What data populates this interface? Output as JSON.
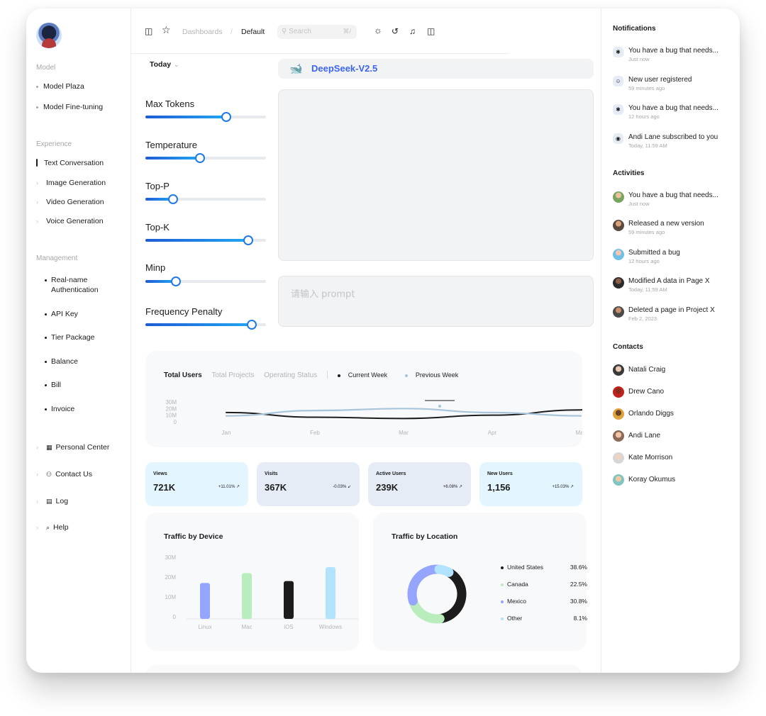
{
  "sidebar": {
    "sections": {
      "model": "Model",
      "experience": "Experience",
      "management": "Management"
    },
    "model_items": [
      "Model Plaza",
      "Model Fine-tuning"
    ],
    "experience_items": [
      "Text Conversation",
      "Image Generation",
      "Video Generation",
      "Voice Generation"
    ],
    "management_items": [
      "Real-name",
      "Authentication",
      "API Key",
      "Tier Package",
      "Balance",
      "Bill",
      "Invoice"
    ],
    "bottom_items": [
      "Personal Center",
      "Contact Us",
      "Log",
      "Help"
    ]
  },
  "header": {
    "breadcrumb_root": "Dashboards",
    "breadcrumb_sep": "/",
    "breadcrumb_current": "Default",
    "search_placeholder": "Search",
    "search_shortcut": "⌘/"
  },
  "settings": {
    "period": "Today",
    "sliders": [
      {
        "label": "Max Tokens",
        "level_pct": 67
      },
      {
        "label": "Temperature",
        "level_pct": 45
      },
      {
        "label": "Top-P",
        "level_pct": 23
      },
      {
        "label": "Top-K",
        "level_pct": 85
      },
      {
        "label": "Minp",
        "level_pct": 25
      },
      {
        "label": "Frequency Penalty",
        "level_pct": 88
      }
    ]
  },
  "chat": {
    "model_name": "DeepSeek-V2.5",
    "prompt_placeholder": "请输入 prompt"
  },
  "users_card": {
    "tabs": [
      "Total Users",
      "Total Projects",
      "Operating Status"
    ],
    "legend": [
      "Current Week",
      "Previous Week"
    ]
  },
  "stats": [
    {
      "title": "Views",
      "value": "721K",
      "change": "+11.01%",
      "bg": "#e3f5ff"
    },
    {
      "title": "Visits",
      "value": "367K",
      "change": "-0.03%",
      "bg": "#e5ecf6"
    },
    {
      "title": "Active Users",
      "value": "239K",
      "change": "+6.08%",
      "bg": "#e5ecf6"
    },
    {
      "title": "New Users",
      "value": "1,156",
      "change": "+15.03%",
      "bg": "#e3f5ff"
    }
  ],
  "device_card": {
    "title": "Traffic by Device"
  },
  "location_card": {
    "title": "Traffic by Location",
    "rows": [
      {
        "name": "United States",
        "pct": "38.6%",
        "color": "#1c1c1c"
      },
      {
        "name": "Canada",
        "pct": "22.5%",
        "color": "#baedbd"
      },
      {
        "name": "Mexico",
        "pct": "30.8%",
        "color": "#95a4fc"
      },
      {
        "name": "Other",
        "pct": "8.1%",
        "color": "#b1e3ff"
      }
    ]
  },
  "notifications": {
    "title": "Notifications",
    "items": [
      {
        "text": "You have a bug that needs...",
        "time": "Just now",
        "icon": "bug-icon"
      },
      {
        "text": "New user registered",
        "time": "59 minutes ago",
        "icon": "user-icon"
      },
      {
        "text": "You have a bug that needs...",
        "time": "12 hours ago",
        "icon": "bug-icon"
      },
      {
        "text": "Andi Lane subscribed to you",
        "time": "Today, 11:59 AM",
        "icon": "broadcast-icon"
      }
    ]
  },
  "activities": {
    "title": "Activities",
    "items": [
      {
        "text": "You have a bug that needs...",
        "time": "Just now"
      },
      {
        "text": "Released a new version",
        "time": "59 minutes ago"
      },
      {
        "text": "Submitted a bug",
        "time": "12 hours ago"
      },
      {
        "text": "Modified A data in Page X",
        "time": "Today, 11:59 AM"
      },
      {
        "text": "Deleted a page in Project X",
        "time": "Feb 2, 2023"
      }
    ]
  },
  "contacts": {
    "title": "Contacts",
    "items": [
      "Natali Craig",
      "Drew Cano",
      "Orlando Diggs",
      "Andi Lane",
      "Kate Morrison",
      "Koray Okumus"
    ]
  },
  "chart_data": [
    {
      "type": "line",
      "x": [
        "Jan",
        "Feb",
        "Mar",
        "Apr",
        "May"
      ],
      "ylim": [
        0,
        30
      ],
      "yticks": [
        "0",
        "10M",
        "20M",
        "30M"
      ],
      "series": [
        {
          "name": "Current Week",
          "color": "#1c1c1c",
          "values": [
            14,
            7,
            5,
            10,
            18
          ]
        },
        {
          "name": "Previous Week",
          "color": "#a8c5da",
          "values": [
            9,
            17,
            20,
            14,
            9
          ]
        }
      ],
      "grid": false
    },
    {
      "type": "bar",
      "categories": [
        "Linux",
        "Mac",
        "iOS",
        "Windows"
      ],
      "values": [
        17,
        22,
        18,
        25
      ],
      "colors": [
        "#95a4fc",
        "#baedbd",
        "#1c1c1c",
        "#b1e3ff"
      ],
      "ylim": [
        0,
        30
      ],
      "yticks": [
        "0",
        "10M",
        "20M",
        "30M"
      ]
    },
    {
      "type": "pie",
      "labels": [
        "United States",
        "Canada",
        "Mexico",
        "Other"
      ],
      "values": [
        38.6,
        22.5,
        30.8,
        8.1
      ],
      "colors": [
        "#1c1c1c",
        "#baedbd",
        "#95a4fc",
        "#b1e3ff"
      ]
    }
  ]
}
